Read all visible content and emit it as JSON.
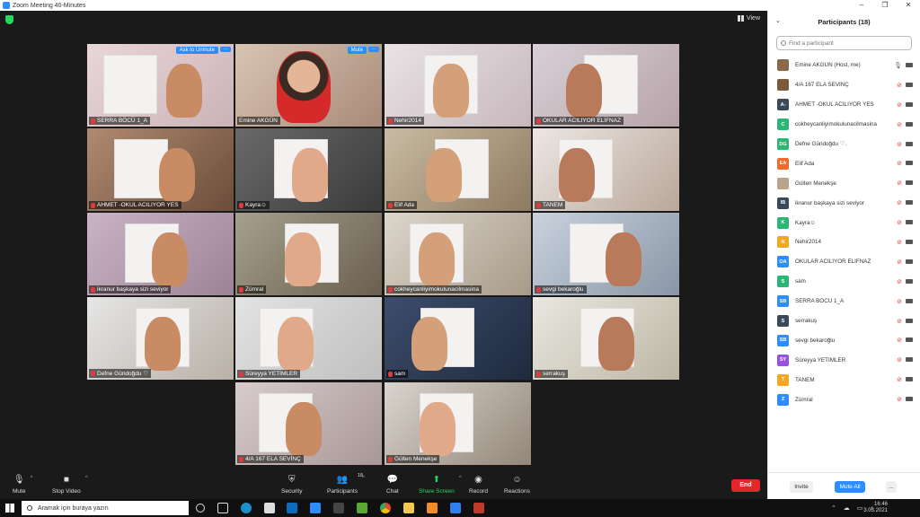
{
  "window": {
    "title": "Zoom Meeting 40-Minutes"
  },
  "view_label": "View",
  "tiles": [
    {
      "name": "SERRA BÖCÜ   1_A",
      "button": "Ask to Unmute",
      "has_more": true
    },
    {
      "name": "Emine AKGÜN",
      "button": "Mute",
      "has_more": true,
      "active": true
    },
    {
      "name": "Nehir2014"
    },
    {
      "name": "OKULAR    ACILIYOR    ELİFNAZ"
    },
    {
      "name": "AHMET -OKUL ACILIYOR YES"
    },
    {
      "name": "Kayra☺"
    },
    {
      "name": "Elif Ada"
    },
    {
      "name": "TANEM"
    },
    {
      "name": "ikranur    başkaya sizi seviyor"
    },
    {
      "name": "Zümral"
    },
    {
      "name": "cokheycanliyimokulunacilmasina"
    },
    {
      "name": "sevgi bekaroğlu"
    },
    {
      "name": "Defne Gündoğdu ♡"
    },
    {
      "name": "Süreyya YETİMLER"
    },
    {
      "name": "sam"
    },
    {
      "name": "serrakuş"
    },
    {
      "name": "4/A 167 ELA SEVİNÇ"
    },
    {
      "name": "Gülten Menekşe"
    }
  ],
  "toolbar": {
    "mute": "Mute",
    "stop_video": "Stop Video",
    "security": "Security",
    "participants": "Participants",
    "participants_count": "18",
    "chat": "Chat",
    "share_screen": "Share Screen",
    "record": "Record",
    "reactions": "Reactions",
    "end": "End"
  },
  "panel": {
    "title": "Participants (18)",
    "search_placeholder": "Find a participant",
    "invite": "Invite",
    "mute_all": "Mute All",
    "more": "...",
    "participants": [
      {
        "initials": "",
        "color": "#8a6a4a",
        "name": "Emine AKGÜN (Host, me)",
        "mic_on": true,
        "cam_on": true
      },
      {
        "initials": "",
        "color": "#7a5a3a",
        "name": "4/A 167 ELA SEVİNÇ",
        "mic_on": false,
        "cam_on": true
      },
      {
        "initials": "A-",
        "color": "#3a4a5a",
        "name": "AHMET -OKUL ACILIYOR YES",
        "mic_on": false,
        "cam_on": true
      },
      {
        "initials": "C",
        "color": "#2bb673",
        "name": "cokheycanliyimokulunacilmasina",
        "mic_on": false,
        "cam_on": true
      },
      {
        "initials": "DG",
        "color": "#2bb673",
        "name": "Defne Gündoğdu ♡.",
        "mic_on": false,
        "cam_on": true
      },
      {
        "initials": "EA",
        "color": "#f26b2a",
        "name": "Elif Ada",
        "mic_on": false,
        "cam_on": true
      },
      {
        "initials": "",
        "color": "#b8a48a",
        "name": "Gülten Menekşe",
        "mic_on": false,
        "cam_on": true
      },
      {
        "initials": "IB",
        "color": "#3a4a5a",
        "name": "ikranur    başkaya sizi seviyor",
        "mic_on": false,
        "cam_on": true
      },
      {
        "initials": "K",
        "color": "#2bb673",
        "name": "Kayra☺",
        "mic_on": false,
        "cam_on": true
      },
      {
        "initials": "N",
        "color": "#f5a623",
        "name": "Nehir2014",
        "mic_on": false,
        "cam_on": true
      },
      {
        "initials": "OA",
        "color": "#2d8cff",
        "name": "OKULAR    ACILIYOR    ELİFNAZ",
        "mic_on": false,
        "cam_on": true
      },
      {
        "initials": "S",
        "color": "#2bb673",
        "name": "sam",
        "mic_on": false,
        "cam_on": true
      },
      {
        "initials": "SB",
        "color": "#2d8cff",
        "name": "SERRA BÖCÜ    1_A",
        "mic_on": false,
        "cam_on": true
      },
      {
        "initials": "S",
        "color": "#3a4a5a",
        "name": "serrakuş",
        "mic_on": false,
        "cam_on": true
      },
      {
        "initials": "SB",
        "color": "#2d8cff",
        "name": "sevgi bekaroğlu",
        "mic_on": false,
        "cam_on": true
      },
      {
        "initials": "SY",
        "color": "#9b51e0",
        "name": "Süreyya YETİMLER",
        "mic_on": false,
        "cam_on": true
      },
      {
        "initials": "T",
        "color": "#f5a623",
        "name": "TANEM",
        "mic_on": false,
        "cam_on": true
      },
      {
        "initials": "Z",
        "color": "#2d8cff",
        "name": "Zümral",
        "mic_on": false,
        "cam_on": true
      }
    ]
  },
  "taskbar": {
    "search_placeholder": "Aramak için buraya yazın",
    "time": "16:46",
    "date": "3.03.2021"
  }
}
